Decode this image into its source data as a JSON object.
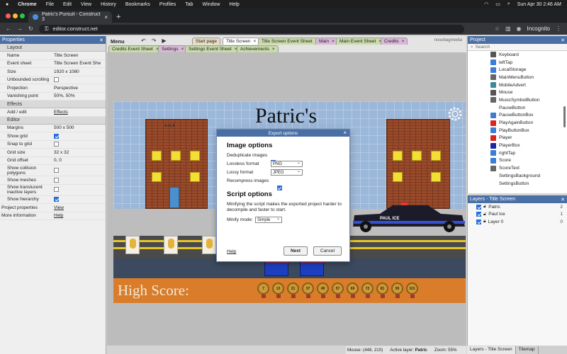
{
  "menubar": {
    "app": "Chrome",
    "items": [
      "File",
      "Edit",
      "View",
      "History",
      "Bookmarks",
      "Profiles",
      "Tab",
      "Window",
      "Help"
    ],
    "clock": "Sun Apr 30  2:46 AM"
  },
  "browser": {
    "tab_title": "Patric's Pursuit - Construct 3",
    "url": "editor.construct.net",
    "profile": "Incognito"
  },
  "properties": {
    "title": "Properties",
    "sections": {
      "layout": "Layout",
      "effects": "Effects",
      "editor": "Editor"
    },
    "name_label": "Name",
    "name_value": "Title Screen",
    "event_sheet_label": "Event sheet",
    "event_sheet_value": "Title Screen Event She",
    "size_label": "Size",
    "size_value": "1920 x 1080",
    "unbounded_label": "Unbounded scrolling",
    "projection_label": "Projection",
    "projection_value": "Perspective",
    "vanishing_label": "Vanishing point",
    "vanishing_value": "50%, 50%",
    "addedit_label": "Add / edit",
    "addedit_value": "Effects",
    "margins_label": "Margins",
    "margins_value": "500 x 500",
    "showgrid_label": "Show grid",
    "snap_label": "Snap to grid",
    "gridsize_label": "Grid size",
    "gridsize_value": "32 x 32",
    "gridoffset_label": "Grid offset",
    "gridoffset_value": "0, 0",
    "collision_label": "Show collision polygons",
    "meshes_label": "Show meshes",
    "translucent_label": "Show translucent inactive layers",
    "hierarchy_label": "Show hierarchy",
    "projprops_label": "Project properties",
    "projprops_value": "View",
    "moreinfo_label": "More information",
    "moreinfo_value": "Help"
  },
  "toolbar": {
    "menu": "Menu",
    "tabs_row1": [
      "Start page",
      "Title Screen",
      "Title Screen Event Sheet",
      "Main",
      "Main Event Sheet",
      "Credits"
    ],
    "tabs_row2": [
      "Credits Event Sheet",
      "Settings",
      "Settings Event Sheet",
      "Achievements"
    ],
    "brand": "nosebagmedia"
  },
  "game": {
    "title": "Patric's",
    "high_score_label": "High Score:",
    "medals": [
      "7",
      "13",
      "21",
      "37",
      "49",
      "57",
      "69",
      "72",
      "81",
      "99",
      "101"
    ],
    "car_text": "PAUL ICE",
    "sign_text": "SALE"
  },
  "dialog": {
    "title": "Export options",
    "image_heading": "Image options",
    "dedup_label": "Deduplicate images",
    "lossless_label": "Lossless format",
    "lossless_value": "PNG",
    "lossy_label": "Lossy format",
    "lossy_value": "JPEG",
    "recompress_label": "Recompress images",
    "script_heading": "Script options",
    "script_desc": "Minifying the script makes the exported project harder to decompile and faster to start.",
    "minify_label": "Minify mode:",
    "minify_value": "Simple",
    "help": "Help",
    "next": "Next",
    "cancel": "Cancel"
  },
  "project": {
    "title": "Project",
    "search_placeholder": "Search",
    "items": [
      "Keyboard",
      "leftTap",
      "LocalStorage",
      "MainMenuButton",
      "MobileAdvert",
      "Mouse",
      "MusicSymbolButton",
      "PauseButton",
      "PauseButtonBox",
      "PlayAgainButton",
      "PlayButtonBox",
      "Player",
      "PlayerBox",
      "rightTap",
      "Score",
      "ScoreText",
      "SettingsBackground",
      "SettingsButton"
    ],
    "item_colors": [
      "#555",
      "#3b7dd8",
      "#3b7dd8",
      "#666",
      "#3a8a9a",
      "#555",
      "#666",
      "#fff",
      "#3b7dd8",
      "#d22",
      "#3b7dd8",
      "#d22",
      "#1a2a9a",
      "#3b7dd8",
      "#3b7dd8",
      "#666",
      "#fff",
      "#fff"
    ]
  },
  "layers": {
    "title": "Layers - Title Screen",
    "rows": [
      {
        "name": "Patric",
        "num": "2"
      },
      {
        "name": "Paul Ice",
        "num": "1"
      },
      {
        "name": "Layer 0",
        "num": "0"
      }
    ]
  },
  "status": {
    "mouse": "Mouse: (448, 210)",
    "active_layer_label": "Active layer:",
    "active_layer_value": "Patric",
    "zoom": "Zoom: 55%"
  },
  "bottom_tabs": [
    "Layers - Title Screen",
    "Tilemap"
  ]
}
